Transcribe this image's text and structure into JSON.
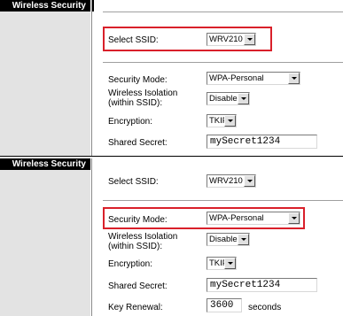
{
  "section_title": "Wireless Security",
  "top_form": {
    "select_ssid_label": "Select SSID:",
    "select_ssid_value": "WRV210",
    "security_mode_label": "Security Mode:",
    "security_mode_value": "WPA-Personal",
    "isolation_label": "Wireless Isolation (within SSID):",
    "isolation_value": "Disabled",
    "encryption_label": "Encryption:",
    "encryption_value": "TKIP",
    "shared_secret_label": "Shared Secret:",
    "shared_secret_value": "mySecret1234"
  },
  "bottom_form": {
    "select_ssid_label": "Select SSID:",
    "select_ssid_value": "WRV210",
    "security_mode_label": "Security Mode:",
    "security_mode_value": "WPA-Personal",
    "isolation_label": "Wireless Isolation (within SSID):",
    "isolation_value": "Disabled",
    "encryption_label": "Encryption:",
    "encryption_value": "TKIP",
    "shared_secret_label": "Shared Secret:",
    "shared_secret_value": "mySecret1234",
    "key_renewal_label": "Key Renewal:",
    "key_renewal_value": "3600",
    "key_renewal_unit": "seconds"
  },
  "colors": {
    "highlight": "#d9202a",
    "header_bg": "#000000",
    "sidebar_bg": "#e3e3e3"
  }
}
